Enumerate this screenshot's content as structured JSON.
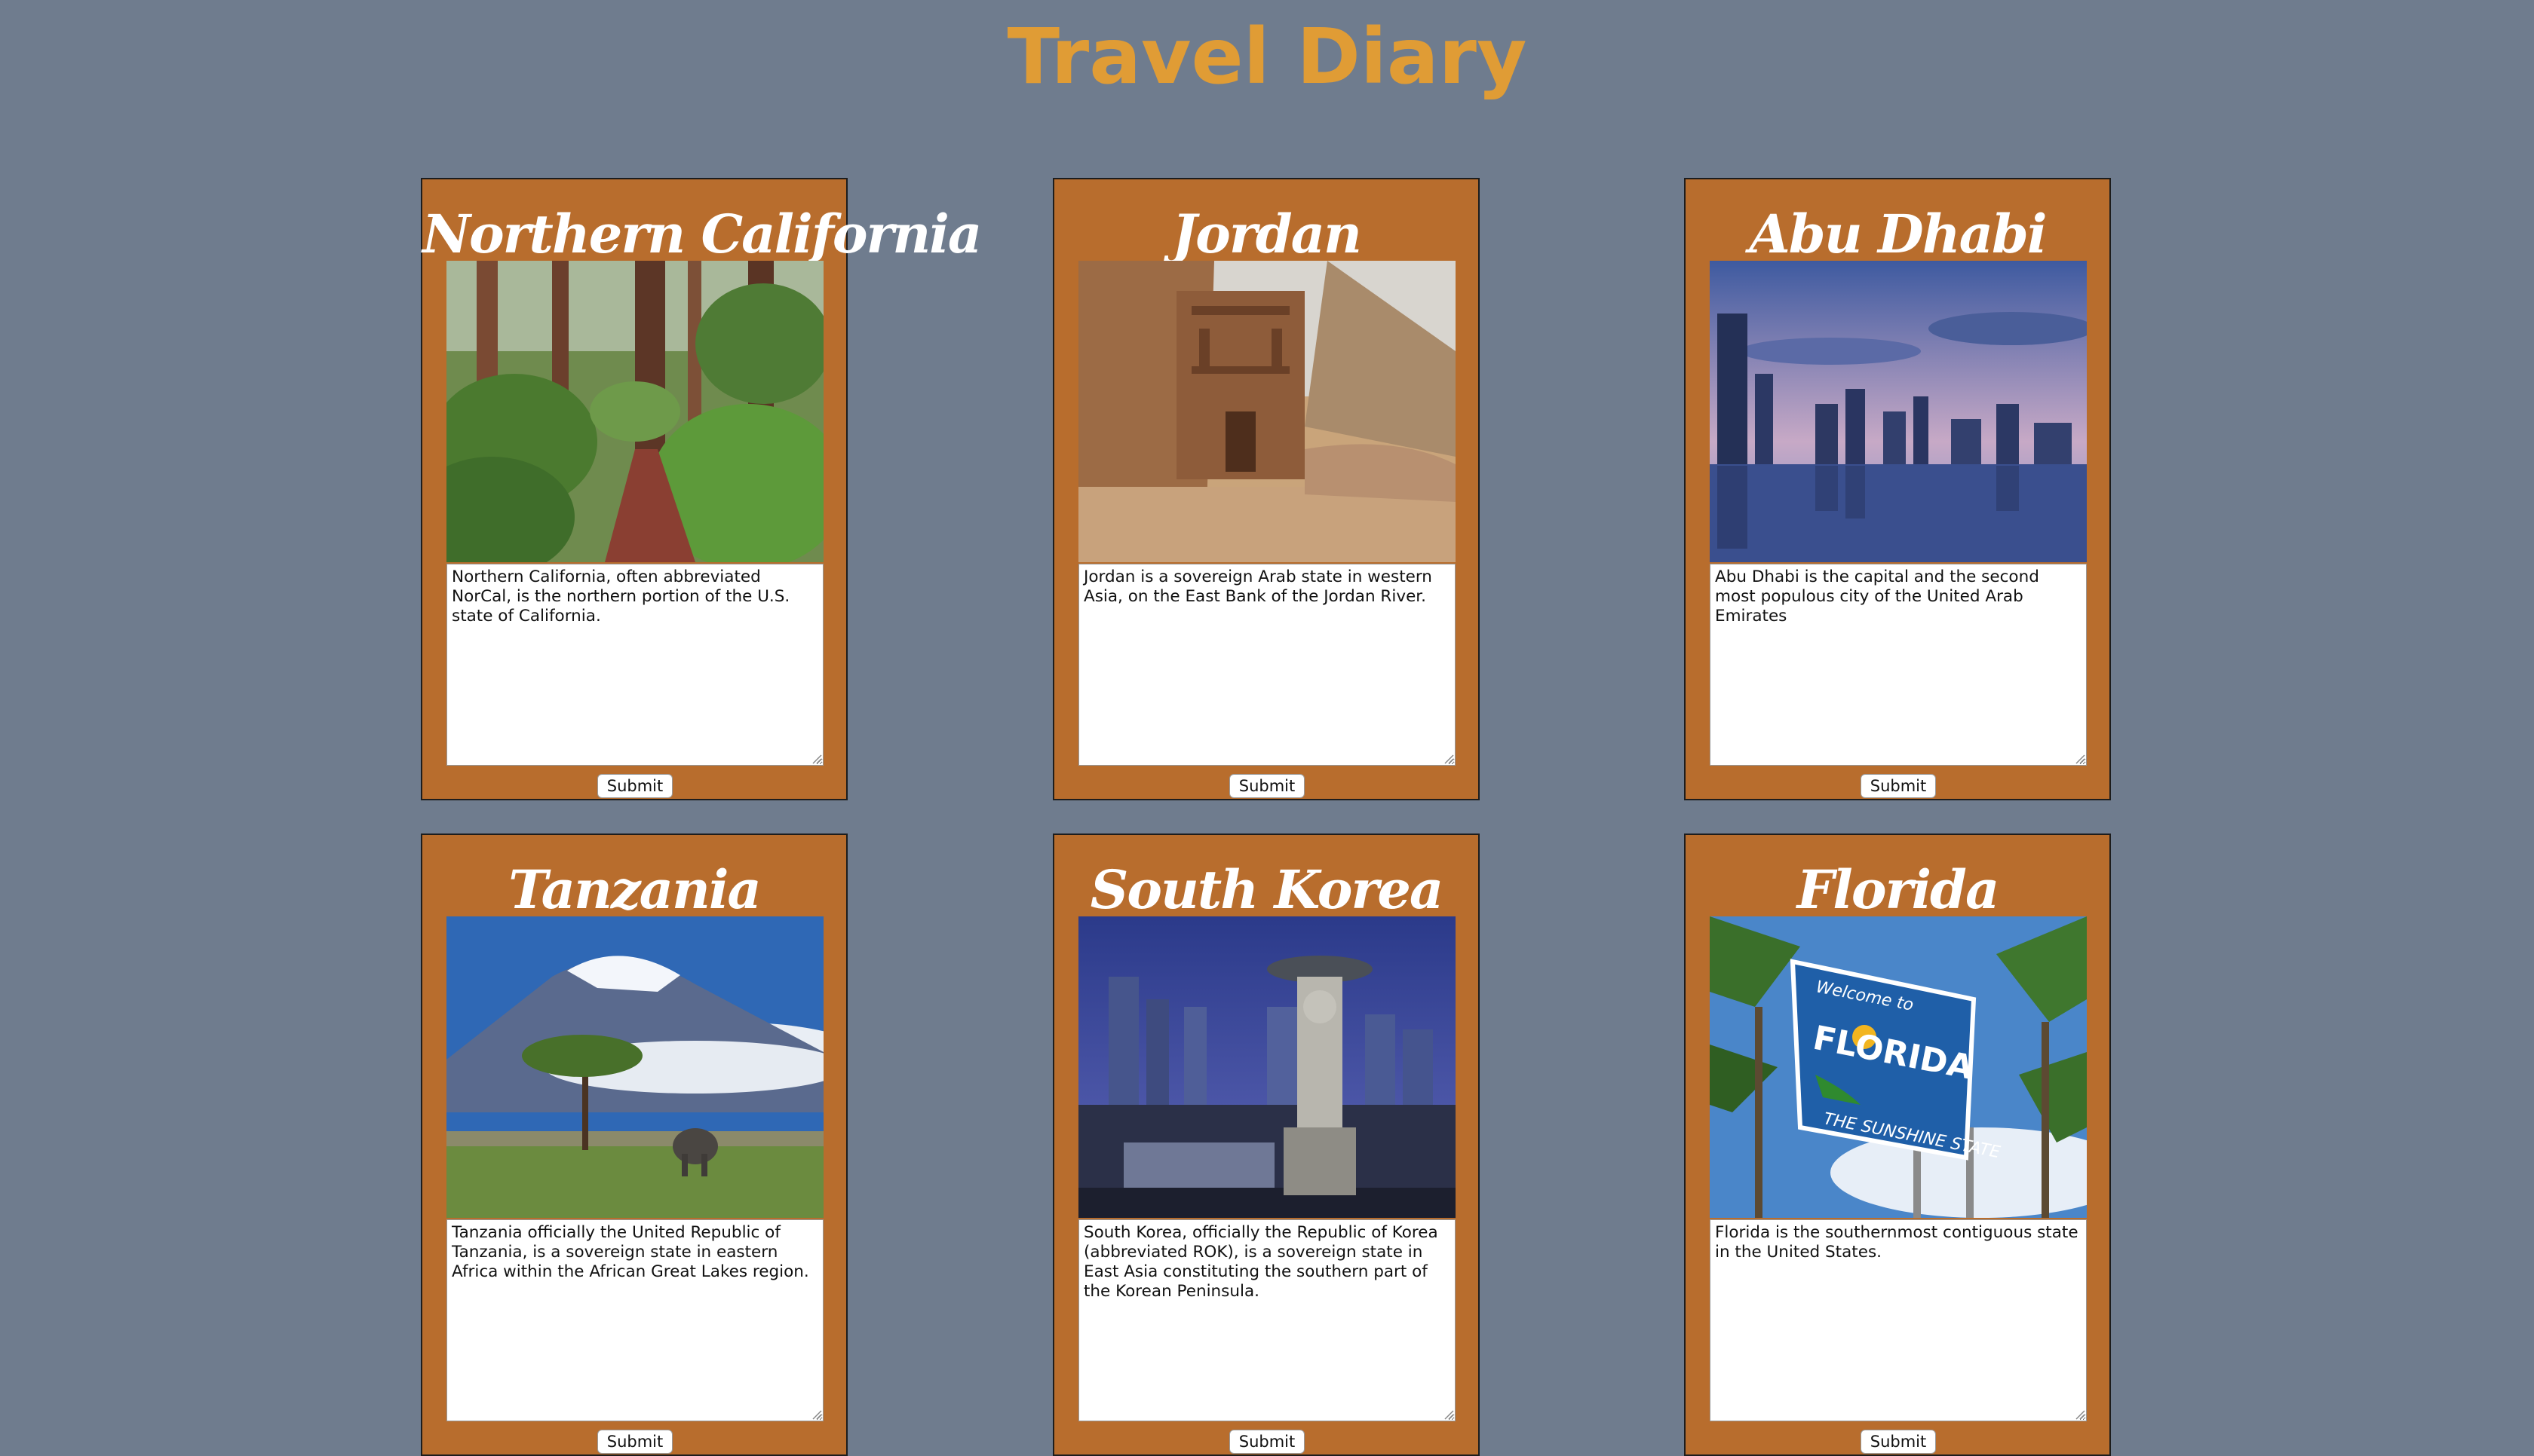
{
  "page": {
    "title": "Travel Diary"
  },
  "colors": {
    "background": "#6f7c8e",
    "title": "#e09c35",
    "card": "#b86d2d"
  },
  "cards": [
    {
      "title": "Northern California",
      "image_icon": "redwood-forest-image",
      "text": "Northern California, often abbreviated NorCal, is the northern portion of the U.S. state of California.",
      "submit_label": "Submit"
    },
    {
      "title": "Jordan",
      "image_icon": "petra-monastery-image",
      "text": "Jordan is a sovereign Arab state in western Asia, on the East Bank of the Jordan River.",
      "submit_label": "Submit"
    },
    {
      "title": "Abu Dhabi",
      "image_icon": "city-skyline-image",
      "text": "Abu Dhabi is the capital and the second most populous city of the United Arab Emirates",
      "submit_label": "Submit"
    },
    {
      "title": "Tanzania",
      "image_icon": "kilimanjaro-elephant-image",
      "text": "Tanzania officially the United Republic of Tanzania, is a sovereign state in eastern Africa within the African Great Lakes region.",
      "submit_label": "Submit"
    },
    {
      "title": "South Korea",
      "image_icon": "seoul-buddha-statue-image",
      "text": "South Korea, officially the Republic of Korea (abbreviated ROK), is a sovereign state in East Asia constituting the southern part of the Korean Peninsula.",
      "submit_label": "Submit"
    },
    {
      "title": "Florida",
      "image_icon": "welcome-sign-palm-image",
      "text": "Florida is the southernmost contiguous state in the United States.",
      "submit_label": "Submit",
      "sign": {
        "line1": "Welcome to",
        "line2": "FLORIDA",
        "line3": "THE SUNSHINE STATE"
      }
    }
  ]
}
